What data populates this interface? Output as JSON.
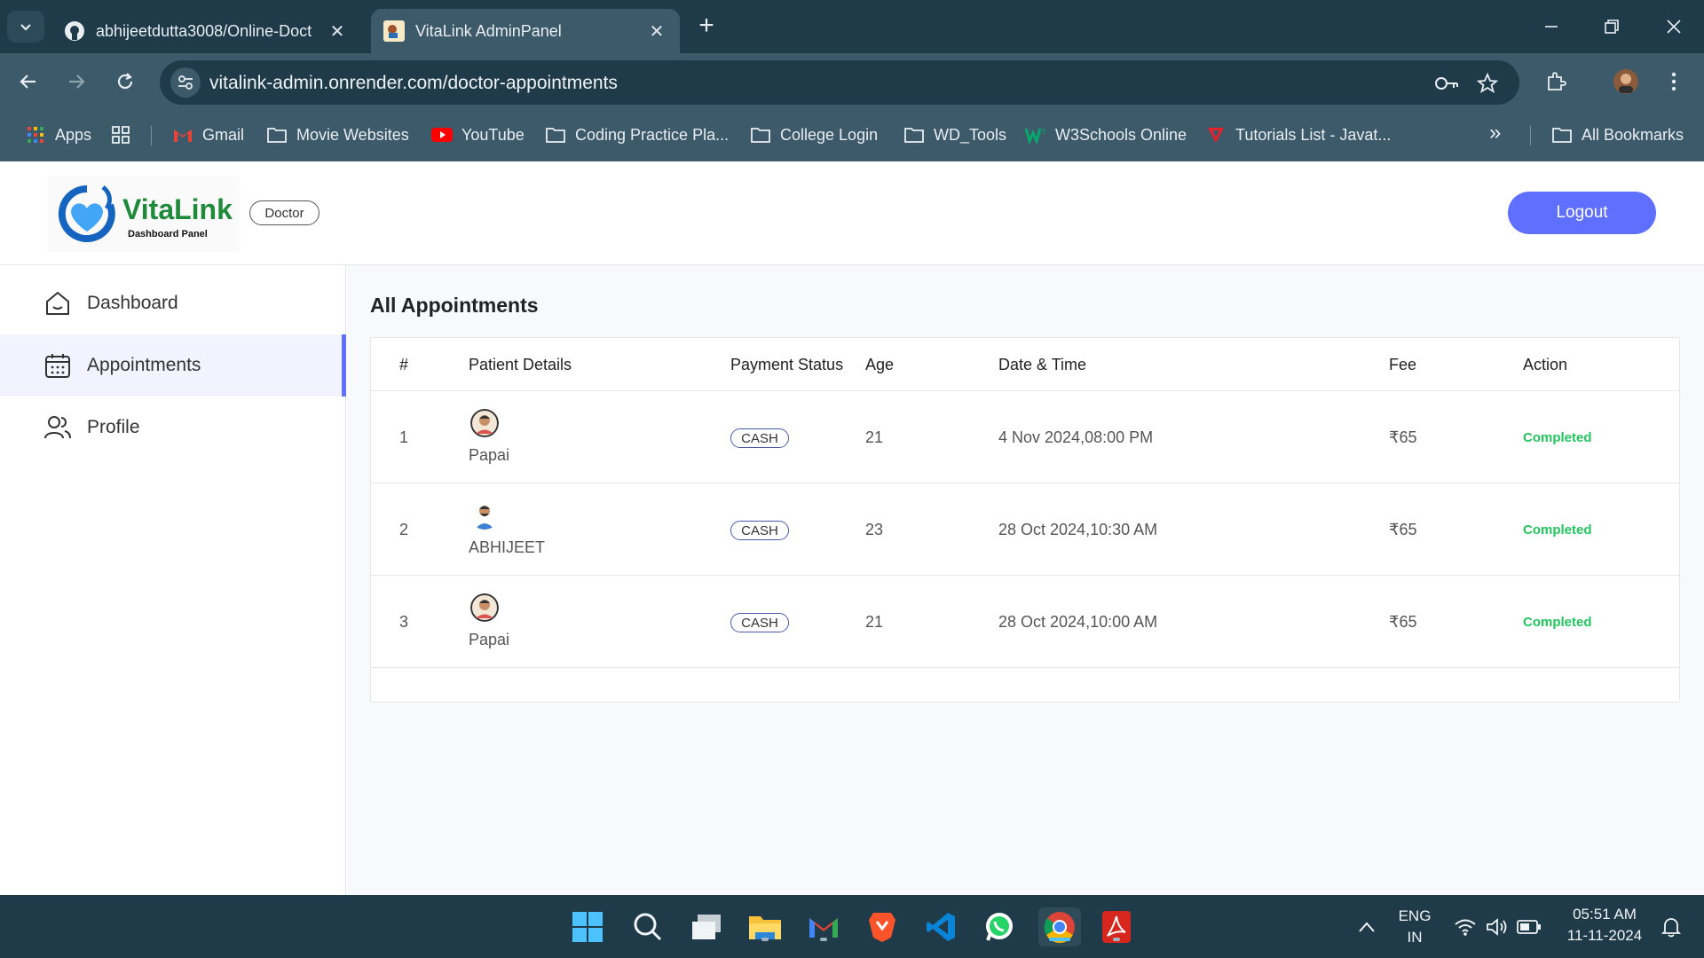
{
  "browser": {
    "tabs": [
      {
        "title": "abhijeetdutta3008/Online-Doct",
        "active": false
      },
      {
        "title": "VitaLink AdminPanel",
        "active": true
      }
    ],
    "new_tab_symbol": "+",
    "close_symbol": "✕",
    "url": "vitalink-admin.onrender.com/doctor-appointments",
    "bookmarks": [
      {
        "label": "Apps",
        "icon": "apps-grid-icon"
      },
      {
        "label": "Gmail",
        "icon": "gmail-icon"
      },
      {
        "label": "Movie Websites",
        "icon": "folder-icon"
      },
      {
        "label": "YouTube",
        "icon": "youtube-icon"
      },
      {
        "label": "Coding Practice Pla...",
        "icon": "folder-icon"
      },
      {
        "label": "College Login",
        "icon": "folder-icon"
      },
      {
        "label": "WD_Tools",
        "icon": "folder-icon"
      },
      {
        "label": "W3Schools Online",
        "icon": "w3schools-icon"
      },
      {
        "label": "Tutorials List - Javat...",
        "icon": "javatpoint-icon"
      }
    ],
    "overflow_symbol": "»",
    "all_bookmarks": "All Bookmarks"
  },
  "app": {
    "brand": "VitaLink",
    "brand_sub": "Dashboard Panel",
    "role": "Doctor",
    "logout": "Logout",
    "sidebar": [
      {
        "label": "Dashboard",
        "icon": "home-icon",
        "active": false
      },
      {
        "label": "Appointments",
        "icon": "calendar-icon",
        "active": true
      },
      {
        "label": "Profile",
        "icon": "people-icon",
        "active": false
      }
    ],
    "page_title": "All Appointments",
    "columns": [
      "#",
      "Patient Details",
      "Payment Status",
      "Age",
      "Date & Time",
      "Fee",
      "Action"
    ],
    "rows": [
      {
        "num": "1",
        "name": "Papai",
        "payment": "CASH",
        "age": "21",
        "datetime": "4 Nov 2024,08:00 PM",
        "fee": "₹65",
        "status": "Completed"
      },
      {
        "num": "2",
        "name": "ABHIJEET",
        "payment": "CASH",
        "age": "23",
        "datetime": "28 Oct 2024,10:30 AM",
        "fee": "₹65",
        "status": "Completed"
      },
      {
        "num": "3",
        "name": "Papai",
        "payment": "CASH",
        "age": "21",
        "datetime": "28 Oct 2024,10:00 AM",
        "fee": "₹65",
        "status": "Completed"
      }
    ]
  },
  "taskbar": {
    "lang_top": "ENG",
    "lang_bottom": "IN",
    "time": "05:51 AM",
    "date": "11-11-2024"
  },
  "colors": {
    "accent": "#5f6fff",
    "status_completed": "#22c55e",
    "chrome_dark": "#1f3a48",
    "chrome_mid": "#3c5a69"
  }
}
